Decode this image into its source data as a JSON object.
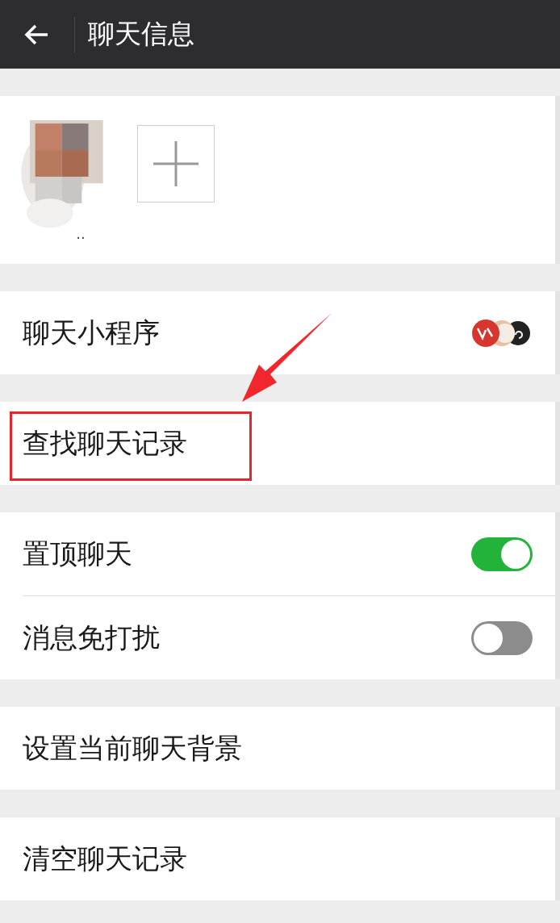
{
  "header": {
    "title": "聊天信息"
  },
  "members": [
    {
      "name": "..",
      "kind": "picture"
    }
  ],
  "sections": [
    {
      "rows": [
        {
          "kind": "mini_programs",
          "label": "聊天小程序",
          "highlighted": false
        }
      ]
    },
    {
      "rows": [
        {
          "kind": "link",
          "label": "查找聊天记录",
          "highlighted": true
        }
      ]
    },
    {
      "rows": [
        {
          "kind": "toggle",
          "label": "置顶聊天",
          "on": true,
          "highlighted": false
        },
        {
          "kind": "toggle",
          "label": "消息免打扰",
          "on": false,
          "highlighted": false
        }
      ]
    },
    {
      "rows": [
        {
          "kind": "link",
          "label": "设置当前聊天背景",
          "highlighted": false
        }
      ]
    },
    {
      "rows": [
        {
          "kind": "link",
          "label": "清空聊天记录",
          "highlighted": false
        }
      ]
    }
  ]
}
